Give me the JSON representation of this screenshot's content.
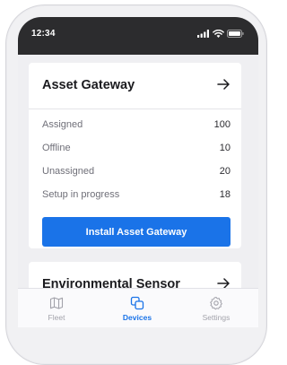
{
  "status_bar": {
    "time": "12:34",
    "icons": [
      "cellular-signal-icon",
      "wifi-icon",
      "battery-icon"
    ]
  },
  "cards": [
    {
      "title": "Asset Gateway",
      "stats": [
        {
          "label": "Assigned",
          "value": "100"
        },
        {
          "label": "Offline",
          "value": "10"
        },
        {
          "label": "Unassigned",
          "value": "20"
        },
        {
          "label": "Setup in progress",
          "value": "18"
        }
      ],
      "button_label": "Install Asset Gateway"
    },
    {
      "title": "Environmental Sensor"
    }
  ],
  "tab_bar": {
    "tabs": [
      {
        "label": "Fleet",
        "icon": "map-icon",
        "active": false
      },
      {
        "label": "Devices",
        "icon": "devices-icon",
        "active": true
      },
      {
        "label": "Settings",
        "icon": "gear-icon",
        "active": false
      }
    ]
  },
  "colors": {
    "accent": "#1a73e8",
    "status_bar_bg": "#2c2c2e",
    "screen_bg": "#efeff2"
  }
}
